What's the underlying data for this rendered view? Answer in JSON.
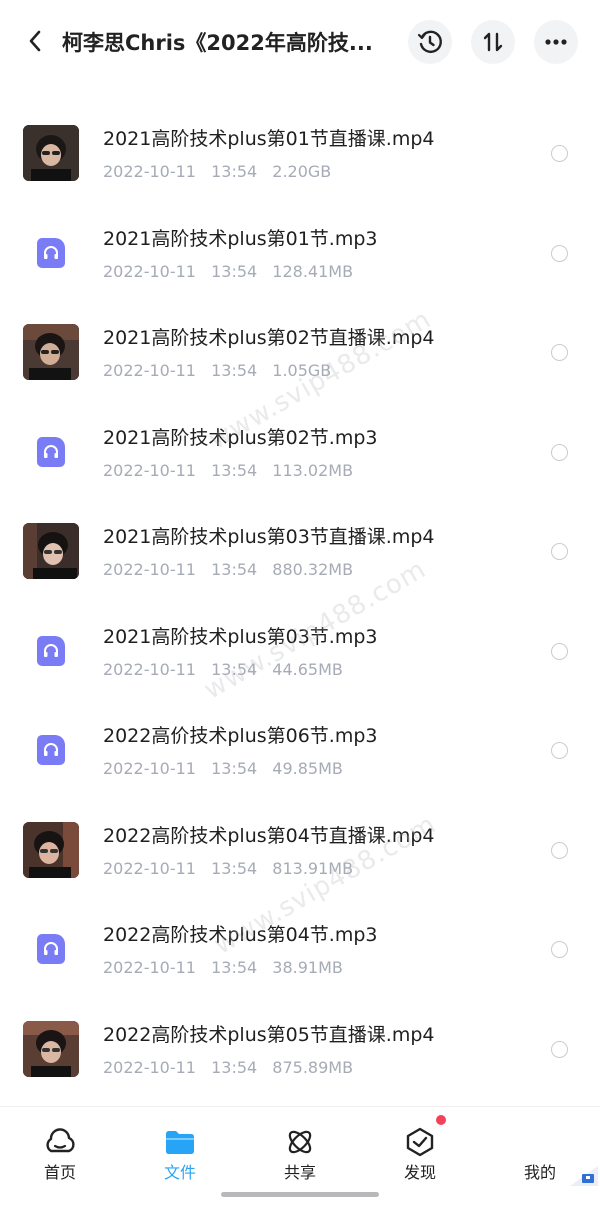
{
  "header": {
    "title": "柯李思Chris《2022年高阶技...",
    "back_icon": "chevron-left-icon",
    "history_icon": "history-icon",
    "sort_icon": "sort-icon",
    "more_icon": "more-icon"
  },
  "files": [
    {
      "name": "2021高阶技术plus第01节直播课.mp4",
      "date": "2022-10-11",
      "time": "13:54",
      "size": "2.20GB",
      "type": "video"
    },
    {
      "name": "2021高阶技术plus第01节.mp3",
      "date": "2022-10-11",
      "time": "13:54",
      "size": "128.41MB",
      "type": "audio"
    },
    {
      "name": "2021高阶技术plus第02节直播课.mp4",
      "date": "2022-10-11",
      "time": "13:54",
      "size": "1.05GB",
      "type": "video"
    },
    {
      "name": "2021高阶技术plus第02节.mp3",
      "date": "2022-10-11",
      "time": "13:54",
      "size": "113.02MB",
      "type": "audio"
    },
    {
      "name": "2021高阶技术plus第03节直播课.mp4",
      "date": "2022-10-11",
      "time": "13:54",
      "size": "880.32MB",
      "type": "video"
    },
    {
      "name": "2021高阶技术plus第03节.mp3",
      "date": "2022-10-11",
      "time": "13:54",
      "size": "44.65MB",
      "type": "audio"
    },
    {
      "name": "2022高价技术plus第06节.mp3",
      "date": "2022-10-11",
      "time": "13:54",
      "size": "49.85MB",
      "type": "audio"
    },
    {
      "name": "2022高阶技术plus第04节直播课.mp4",
      "date": "2022-10-11",
      "time": "13:54",
      "size": "813.91MB",
      "type": "video"
    },
    {
      "name": "2022高阶技术plus第04节.mp3",
      "date": "2022-10-11",
      "time": "13:54",
      "size": "38.91MB",
      "type": "audio"
    },
    {
      "name": "2022高阶技术plus第05节直播课.mp4",
      "date": "2022-10-11",
      "time": "13:54",
      "size": "875.89MB",
      "type": "video"
    }
  ],
  "watermark": "www.svip488.com",
  "tabbar": {
    "tabs": [
      {
        "label": "首页",
        "icon": "home-cloud-icon"
      },
      {
        "label": "文件",
        "icon": "folder-icon",
        "active": true
      },
      {
        "label": "共享",
        "icon": "share-atom-icon"
      },
      {
        "label": "发现",
        "icon": "discover-box-icon"
      },
      {
        "label": "我的",
        "icon": "profile-icon"
      }
    ]
  },
  "colors": {
    "accent": "#2aa3f5",
    "audio_icon": "#7a7cf5",
    "meta_text": "#a6abb6",
    "badge": "#f2415a"
  }
}
